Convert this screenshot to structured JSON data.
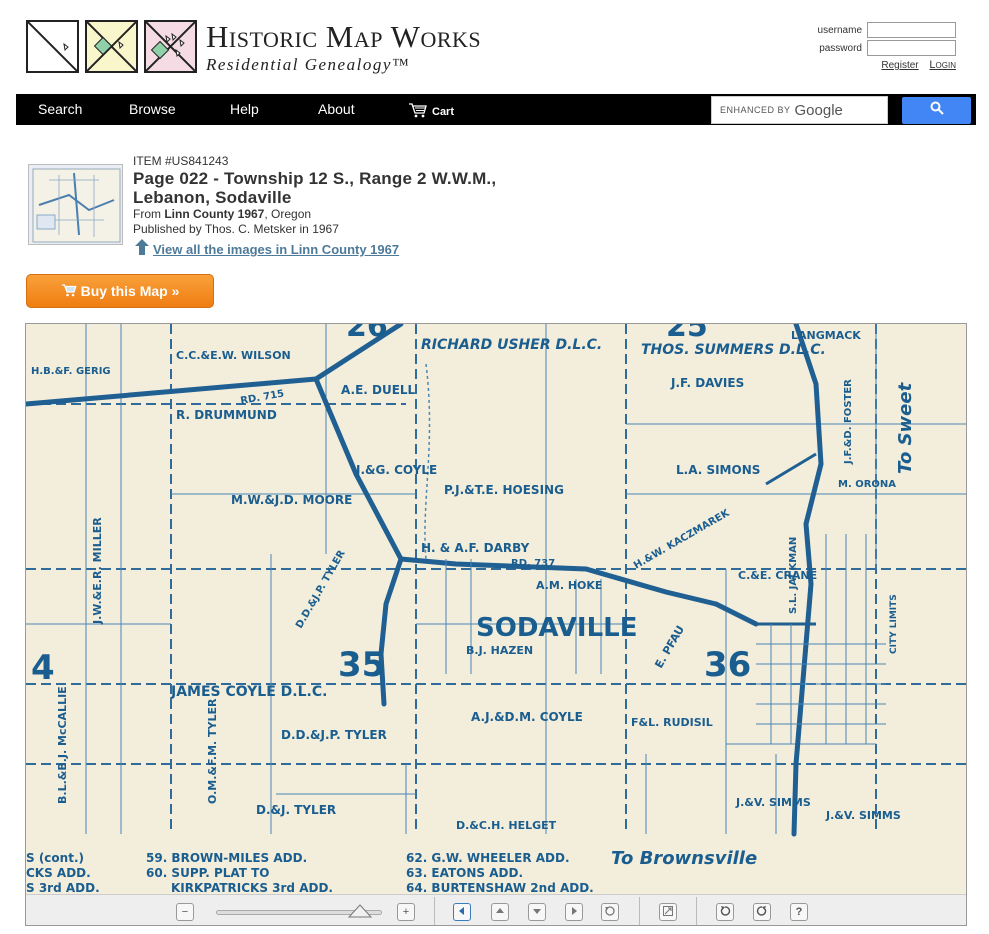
{
  "brand": {
    "title": "Historic Map Works",
    "subtitle": "Residential Genealogy™"
  },
  "login": {
    "username_label": "username",
    "password_label": "password",
    "register": "Register",
    "login": "Login"
  },
  "nav": {
    "search": "Search",
    "browse": "Browse",
    "help": "Help",
    "about": "About",
    "cart": "Cart"
  },
  "google_search": {
    "prefix": "ENHANCED BY",
    "brand": "Google"
  },
  "item": {
    "id": "ITEM #US841243",
    "title": "Page 022 - Township 12 S., Range 2 W.W.M., Lebanon, Sodaville",
    "from_label": "From ",
    "county": "Linn County 1967",
    "state": ", Oregon",
    "published": "Published by Thos. C. Metsker in 1967",
    "view_all": "View all the images in Linn County 1967"
  },
  "buy_button": "Buy this Map »",
  "map": {
    "labels": {
      "sodaville": "SODAVILLE",
      "sec35": "35",
      "sec36": "36",
      "sec25": "25",
      "sec26": "26",
      "sec4": "4",
      "usher": "RICHARD USHER D.L.C.",
      "summers": "THOS. SUMMERS D.L.C.",
      "langmack": "LANGMACK",
      "davies": "J.F. DAVIES",
      "wilson": "C.C.&E.W. WILSON",
      "drummund": "R. DRUMMUND",
      "duell": "A.E. DUELL",
      "coyle_jg": "J.&G. COYLE",
      "hoesing": "P.J.&T.E. HOESING",
      "simons": "L.A. SIMONS",
      "moore": "M.W.&J.D. MOORE",
      "darby": "H. & A.F. DARBY",
      "miller": "J.W.&E.R. MILLER",
      "james_coyle": "JAMES COYLE D.L.C.",
      "tyler_dd": "D.D.&J.P. TYLER",
      "tyler_dd2": "D.D.&J.P. TYLER",
      "coyle_aj": "A.J.&D.M. COYLE",
      "rudisil": "F&L. RUDISIL",
      "hazen": "B.J. HAZEN",
      "hoke": "A.M. HOKE",
      "pfau": "E. PFAU",
      "crane": "C.&E. CRANE",
      "kaczmarek": "H.&W. KACZMAREK",
      "jackman": "S.L. JACKMAN",
      "mccallie": "B.L.&B.J. McCALLIE",
      "tyler_om": "O.M.&F.M. TYLER",
      "tyler_dj": "D.&J. TYLER",
      "helget": "D.&C.H. HELGET",
      "simms1": "J.&V. SIMMS",
      "simms2": "J.&V. SIMMS",
      "foster": "J.F.&D. FOSTER",
      "orona": "M. ORONA",
      "to_sweet": "To Sweet",
      "to_brownsville": "To Brownsville",
      "rd715": "RD. 715",
      "rd737": "RD. 737",
      "city_limits": "CITY LIMITS",
      "geric": "H.B.&F. GERIG",
      "legend_1": "S (cont.)",
      "legend_2": "CKS ADD.",
      "legend_3": "S 3rd ADD.",
      "legend_59": "59. BROWN-MILES ADD.",
      "legend_60": "60. SUPP. PLAT TO",
      "legend_60b": "KIRKPATRICKS 3rd ADD.",
      "legend_62": "62. G.W. WHEELER ADD.",
      "legend_63": "63. EATONS ADD.",
      "legend_64": "64. BURTENSHAW 2nd ADD."
    }
  }
}
